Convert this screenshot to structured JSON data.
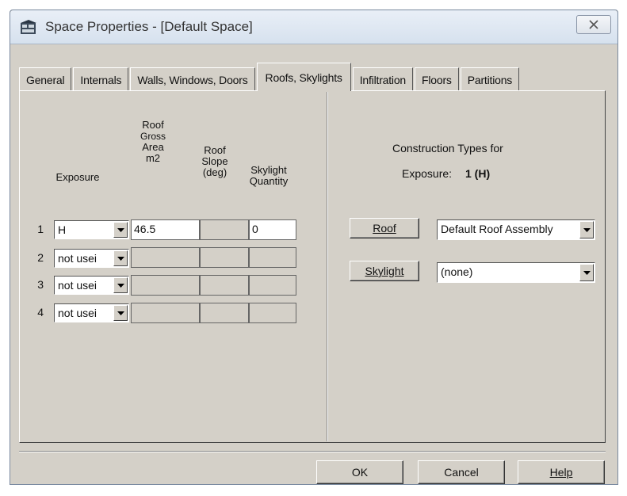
{
  "window": {
    "title": "Space Properties - [Default Space]"
  },
  "tabs": [
    {
      "label": "General"
    },
    {
      "label": "Internals"
    },
    {
      "label": "Walls, Windows, Doors"
    },
    {
      "label": "Roofs, Skylights"
    },
    {
      "label": "Infiltration"
    },
    {
      "label": "Floors"
    },
    {
      "label": "Partitions"
    }
  ],
  "active_tab": "Roofs, Skylights",
  "table": {
    "headers": {
      "exposure": "Exposure",
      "roof_gross_area_1": "Roof",
      "roof_gross_area_2": "Gross",
      "roof_gross_area_3": "Area",
      "roof_gross_area_4": "m2",
      "roof_slope_1": "Roof",
      "roof_slope_2": "Slope",
      "roof_slope_3": "(deg)",
      "skylight_1": "Skylight",
      "skylight_2": "Quantity"
    },
    "rows": [
      {
        "num": "1",
        "exposure": "H",
        "area": "46.5",
        "slope": "",
        "skylights": "0"
      },
      {
        "num": "2",
        "exposure": "not usei",
        "area": "",
        "slope": "",
        "skylights": ""
      },
      {
        "num": "3",
        "exposure": "not usei",
        "area": "",
        "slope": "",
        "skylights": ""
      },
      {
        "num": "4",
        "exposure": "not usei",
        "area": "",
        "slope": "",
        "skylights": ""
      }
    ]
  },
  "construction": {
    "title": "Construction Types for",
    "exposure_label": "Exposure:",
    "exposure_value": "1 (H)",
    "roof_button": "Roof",
    "roof_value": "Default Roof Assembly",
    "skylight_button": "Skylight",
    "skylight_value": "(none)"
  },
  "buttons": {
    "ok": "OK",
    "cancel": "Cancel",
    "help": "Help"
  },
  "colors": {
    "dialog_bg": "#d4d0c8",
    "titlebar": "#dfe7f1"
  }
}
